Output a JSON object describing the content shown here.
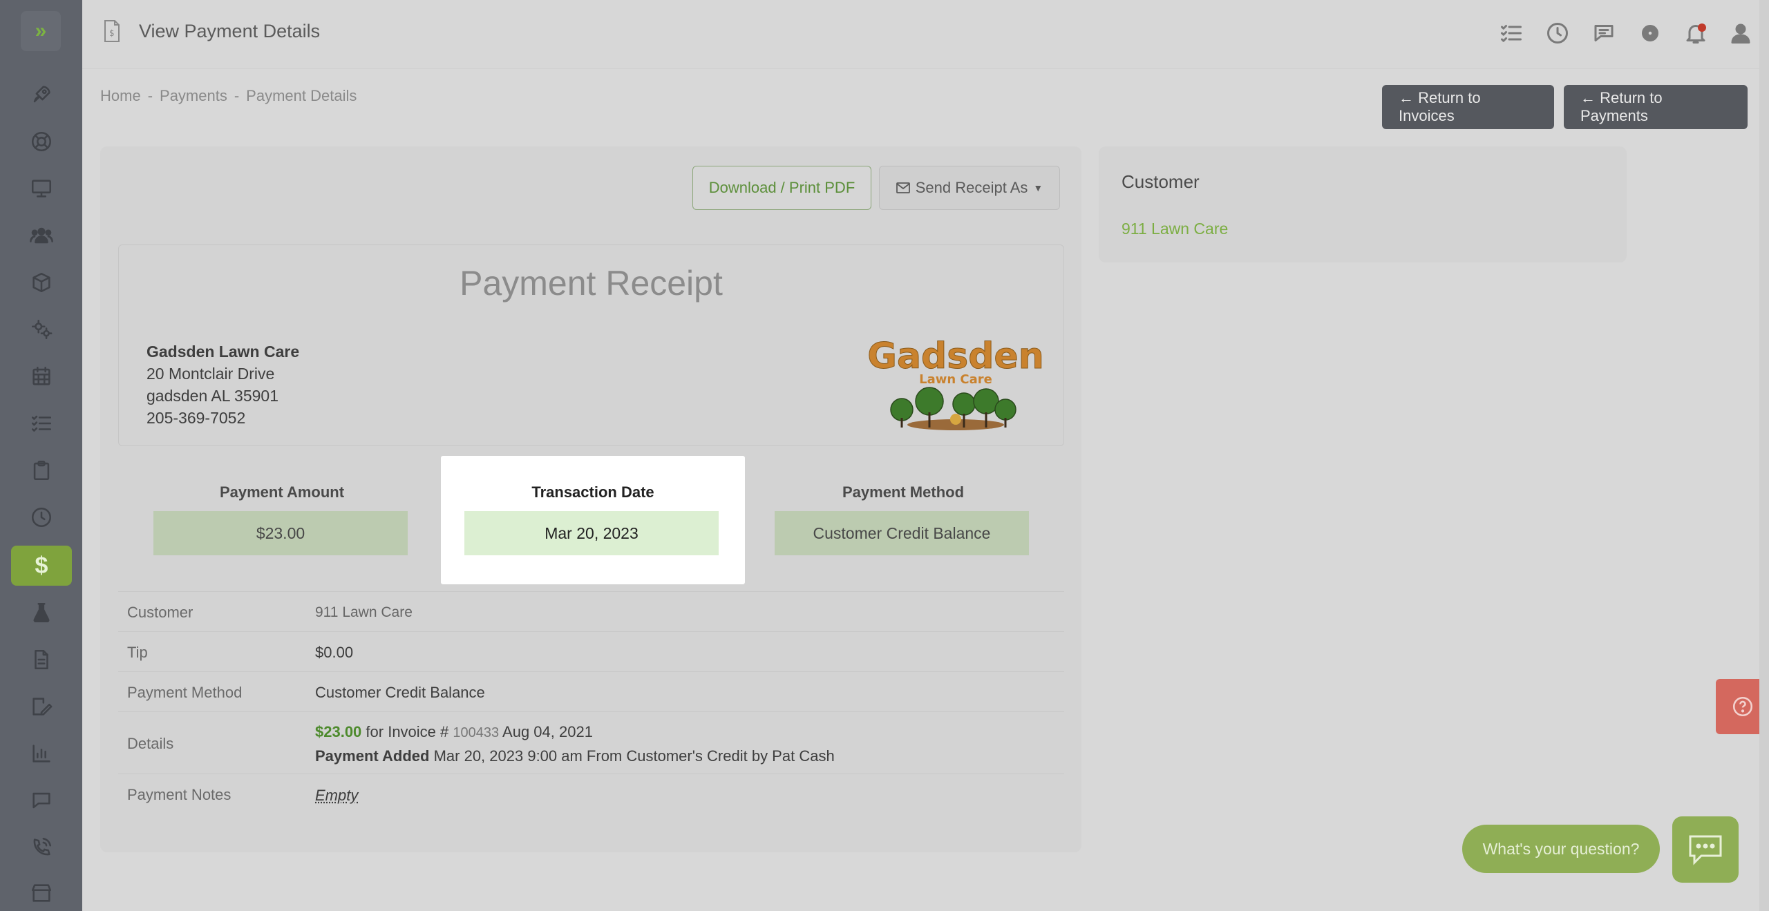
{
  "header": {
    "title": "View Payment Details",
    "icons": [
      "checklist-icon",
      "clock-icon",
      "chat-icon",
      "gear-icon",
      "bell-icon",
      "user-icon"
    ]
  },
  "sidebar": {
    "items": [
      "rocket-icon",
      "lifebuoy-icon",
      "monitor-icon",
      "users-icon",
      "box-icon",
      "gears-icon",
      "calendar-icon",
      "checklist-icon",
      "clipboard-icon",
      "clock-icon",
      "dollar-icon",
      "flask-icon",
      "document-icon",
      "signature-icon",
      "chart-icon",
      "chat-icon",
      "phone-icon",
      "store-icon"
    ],
    "active": "$",
    "active_color": "#7fa33d"
  },
  "breadcrumb": [
    "Home",
    "-",
    "Payments",
    "-",
    "Payment Details"
  ],
  "buttons": {
    "return_invoices": "← Return to Invoices",
    "return_payments": "← Return to Payments",
    "download_pdf": "Download / Print PDF",
    "send_receipt": "Send Receipt As"
  },
  "receipt": {
    "title": "Payment Receipt",
    "company_name": "Gadsden Lawn Care",
    "address1": "20 Montclair Drive",
    "address2": "gadsden AL 35901",
    "phone": "205-369-7052",
    "logo_text": "Gadsden",
    "logo_sub": "Lawn Care"
  },
  "summary": {
    "amount_label": "Payment Amount",
    "amount_value": "$23.00",
    "date_label": "Transaction Date",
    "date_value": "Mar 20, 2023",
    "method_label": "Payment Method",
    "method_value": "Customer Credit Balance"
  },
  "details": {
    "customer_label": "Customer",
    "customer_value": "911 Lawn Care",
    "tip_label": "Tip",
    "tip_value": "$0.00",
    "method_label": "Payment Method",
    "method_value": "Customer Credit Balance",
    "details_label": "Details",
    "details_amount": "$23.00",
    "details_for": "for Invoice #",
    "details_invoice": "100433",
    "details_date": "Aug 04, 2021",
    "details_added_label": "Payment Added",
    "details_added_text": "Mar 20, 2023 9:00 am From Customer's Credit by Pat Cash",
    "notes_label": "Payment Notes",
    "notes_value": "Empty"
  },
  "customer_card": {
    "heading": "Customer",
    "link": "911 Lawn Care"
  },
  "chat": {
    "bubble": "What's your question?"
  },
  "colors": {
    "accent_green": "#7fa33d",
    "link_green": "#7cae43",
    "help_red": "#d4685e"
  }
}
